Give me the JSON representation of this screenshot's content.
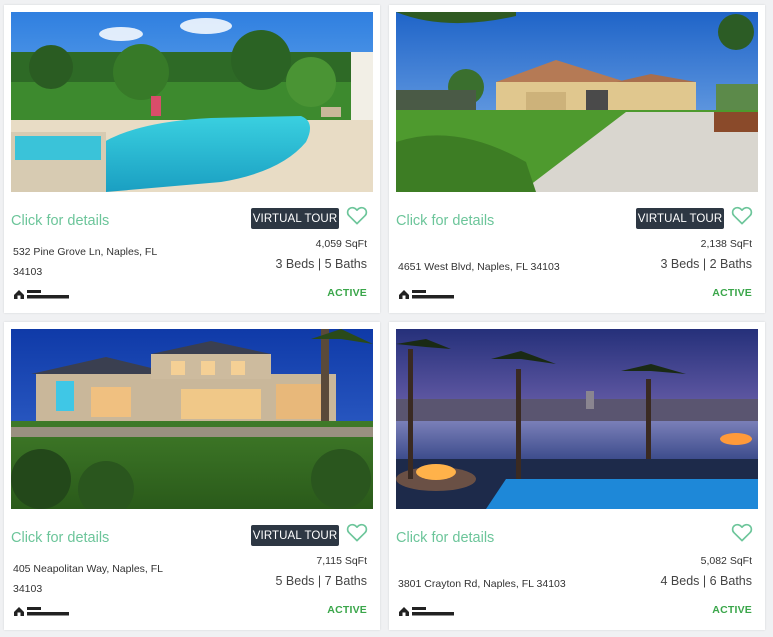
{
  "listings": [
    {
      "details_label": "Click for details",
      "virtual_tour_label": "VIRTUAL TOUR",
      "address": "532 Pine Grove Ln, Naples, FL 34103",
      "sqft": "4,059 SqFt",
      "beds_baths": "3 Beds | 5 Baths",
      "status": "ACTIVE",
      "photo": "pool-patio-photo"
    },
    {
      "details_label": "Click for details",
      "virtual_tour_label": "VIRTUAL TOUR",
      "address": "4651 West Blvd, Naples, FL 34103",
      "sqft": "2,138 SqFt",
      "beds_baths": "3 Beds | 2 Baths",
      "status": "ACTIVE",
      "photo": "ranch-house-photo"
    },
    {
      "details_label": "Click for details",
      "virtual_tour_label": "VIRTUAL TOUR",
      "address": "405 Neapolitan Way, Naples, FL 34103",
      "sqft": "7,115 SqFt",
      "beds_baths": "5 Beds | 7 Baths",
      "status": "ACTIVE",
      "photo": "mansion-dusk-photo"
    },
    {
      "details_label": "Click for details",
      "address": "3801 Crayton Rd, Naples, FL 34103",
      "sqft": "5,082 SqFt",
      "beds_baths": "4 Beds | 6 Baths",
      "status": "ACTIVE",
      "photo": "waterfront-pool-dusk-photo"
    }
  ],
  "broker_logo_text": "Broker Reciprocity",
  "colors": {
    "link": "#6cc59a",
    "status": "#3aa64a",
    "button_bg": "#2d3743",
    "heart": "#6cc59a"
  }
}
